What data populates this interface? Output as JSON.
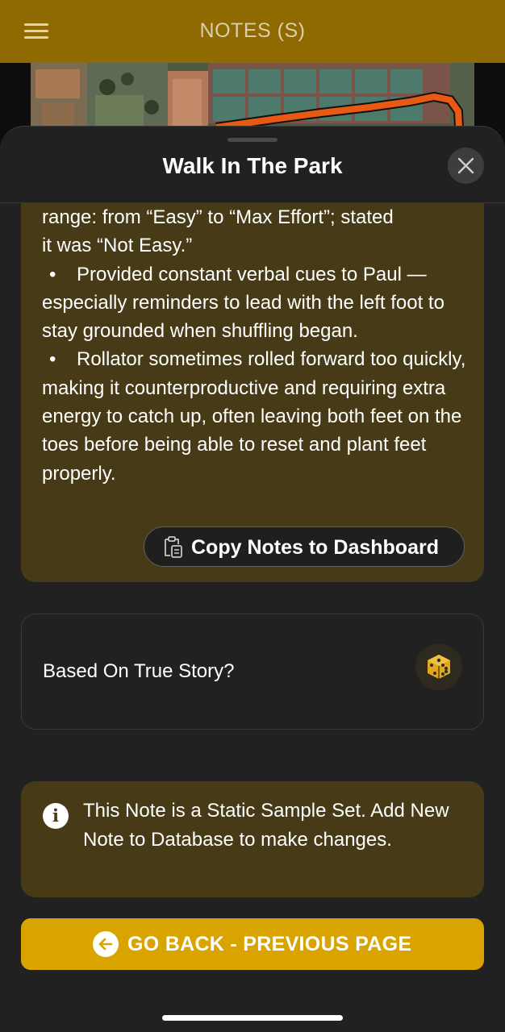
{
  "app_bar": {
    "title": "NOTES (S)",
    "background": "#8f6a00",
    "menu_icon": "hamburger-menu-icon"
  },
  "sheet": {
    "title": "Walk In The Park",
    "close_icon": "close-icon"
  },
  "notes": {
    "line_1": "range: from “Easy” to “Max Effort”; stated",
    "line_2": "it was “Not Easy.”",
    "bullets": [
      "Provided constant verbal cues to Paul —especially reminders to lead with the left foot to stay grounded when shuffling began.",
      "Rollator sometimes rolled forward too quickly, making it counterproductive and requiring extra energy to catch up, often leaving both feet on the toes before being able to reset and plant feet properly."
    ],
    "bullet_glyph": "•",
    "copy_button_label": "Copy Notes to Dashboard",
    "copy_icon": "clipboard-icon",
    "background": "#473a17"
  },
  "true_story": {
    "label": "Based On True Story?",
    "icon": "dice-icon"
  },
  "info": {
    "text": "This Note is a Static Sample Set. Add New Note to Database to make changes.",
    "icon": "info-icon",
    "glyph": "i"
  },
  "back_button": {
    "label": "GO BACK - PREVIOUS PAGE",
    "icon": "arrow-left-icon",
    "background": "#d9a300"
  }
}
